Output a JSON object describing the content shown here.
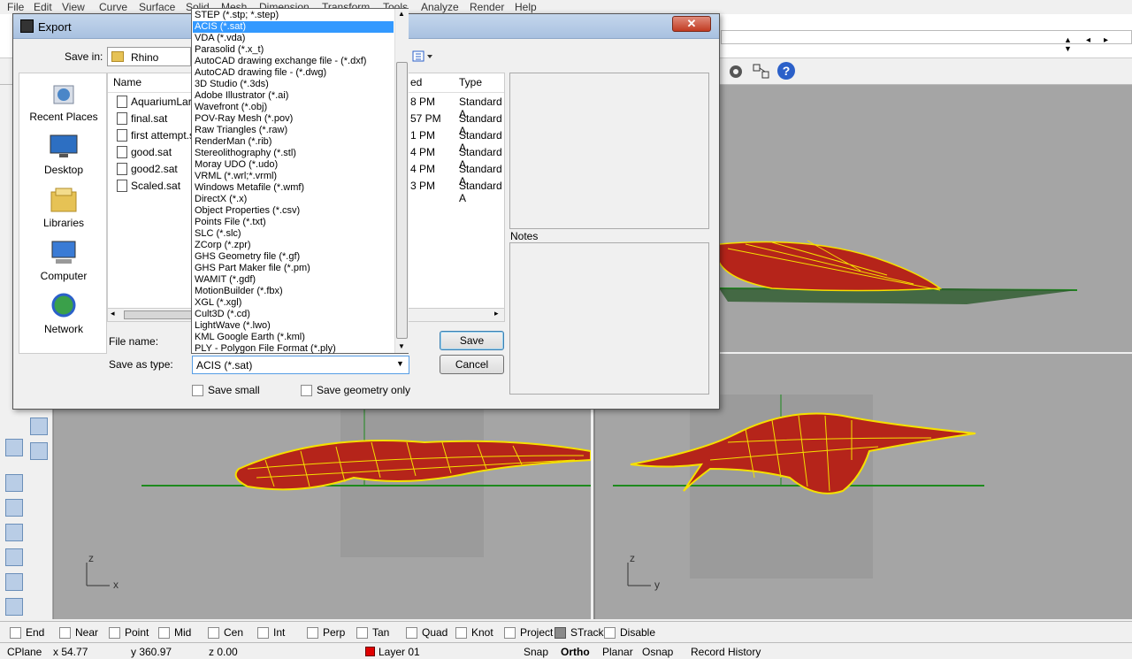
{
  "menubar": [
    "File",
    "Edit",
    "View",
    "Curve",
    "Surface",
    "Solid",
    "Mesh",
    "Dimension",
    "Transform",
    "Tools",
    "Analyze",
    "Render",
    "Help"
  ],
  "dialog": {
    "title": "Export",
    "close_label": "✕",
    "save_in_label": "Save in:",
    "save_in_value": "Rhino",
    "places": [
      {
        "label": "Recent Places",
        "icon": "recent-places-icon"
      },
      {
        "label": "Desktop",
        "icon": "desktop-icon"
      },
      {
        "label": "Libraries",
        "icon": "libraries-icon"
      },
      {
        "label": "Computer",
        "icon": "computer-icon"
      },
      {
        "label": "Network",
        "icon": "network-icon"
      }
    ],
    "columns": {
      "name": "Name",
      "date": "ed",
      "type": "Type"
    },
    "files": [
      {
        "name": "AquariumLar",
        "date": "8 PM",
        "type": "Standard A"
      },
      {
        "name": "final.sat",
        "date": "57 PM",
        "type": "Standard A"
      },
      {
        "name": "first attempt.s",
        "date": "1 PM",
        "type": "Standard A"
      },
      {
        "name": "good.sat",
        "date": "4 PM",
        "type": "Standard A"
      },
      {
        "name": "good2.sat",
        "date": "4 PM",
        "type": "Standard A"
      },
      {
        "name": "Scaled.sat",
        "date": "3 PM",
        "type": "Standard A"
      }
    ],
    "notes_label": "Notes",
    "file_name_label": "File name:",
    "save_as_type_label": "Save as type:",
    "save_as_type_value": "ACIS (*.sat)",
    "save_button": "Save",
    "cancel_button": "Cancel",
    "save_small_label": "Save small",
    "save_geometry_only_label": "Save geometry only",
    "file_types": [
      "STEP (*.stp; *.step)",
      "ACIS (*.sat)",
      "VDA (*.vda)",
      "Parasolid (*.x_t)",
      "AutoCAD drawing exchange file - (*.dxf)",
      "AutoCAD drawing file - (*.dwg)",
      "3D Studio (*.3ds)",
      "Adobe Illustrator (*.ai)",
      "Wavefront (*.obj)",
      "POV-Ray Mesh (*.pov)",
      "Raw Triangles (*.raw)",
      "RenderMan (*.rib)",
      "Stereolithography (*.stl)",
      "Moray UDO (*.udo)",
      "VRML (*.wrl;*.vrml)",
      "Windows Metafile (*.wmf)",
      "DirectX (*.x)",
      "Object Properties (*.csv)",
      "Points File (*.txt)",
      "SLC (*.slc)",
      "ZCorp (*.zpr)",
      "GHS Geometry file (*.gf)",
      "GHS Part Maker file (*.pm)",
      "WAMIT (*.gdf)",
      "MotionBuilder (*.fbx)",
      "XGL (*.xgl)",
      "Cult3D (*.cd)",
      "LightWave (*.lwo)",
      "KML Google Earth (*.kml)",
      "PLY - Polygon File Format (*.ply)"
    ],
    "selected_type_index": 1
  },
  "viewports": {
    "bottom_left_axes": {
      "vertical": "z",
      "horizontal": "x"
    },
    "bottom_right_axes": {
      "vertical": "z",
      "horizontal": "y"
    }
  },
  "osnap": [
    {
      "label": "End",
      "checked": false
    },
    {
      "label": "Near",
      "checked": false
    },
    {
      "label": "Point",
      "checked": false
    },
    {
      "label": "Mid",
      "checked": false
    },
    {
      "label": "Cen",
      "checked": false
    },
    {
      "label": "Int",
      "checked": false
    },
    {
      "label": "Perp",
      "checked": false
    },
    {
      "label": "Tan",
      "checked": false
    },
    {
      "label": "Quad",
      "checked": false
    },
    {
      "label": "Knot",
      "checked": false
    },
    {
      "label": "Project",
      "checked": false
    },
    {
      "label": "STrack",
      "checked": true
    },
    {
      "label": "Disable",
      "checked": false
    }
  ],
  "status": {
    "cplane": "CPlane",
    "x": "x 54.77",
    "y": "y 360.97",
    "z": "z 0.00",
    "layer": "Layer 01",
    "layer_color": "#e00000",
    "snap": "Snap",
    "ortho": "Ortho",
    "planar": "Planar",
    "osnap": "Osnap",
    "record_history": "Record History"
  },
  "colors": {
    "viewport_bg": "#a5a5a5",
    "surface_fill": "#b5241a",
    "surface_wire": "#f5e000",
    "ground_line": "#1e8a1e",
    "selection": "#3399ff"
  }
}
